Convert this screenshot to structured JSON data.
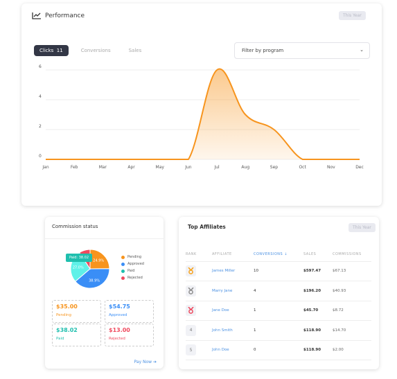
{
  "performance": {
    "title": "Performance",
    "badge": "This Year",
    "tabs": [
      {
        "label": "Clicks",
        "count": "11",
        "active": true
      },
      {
        "label": "Conversions"
      },
      {
        "label": "Sales"
      }
    ],
    "filter_placeholder": "Filter by program"
  },
  "chart_data": {
    "type": "area",
    "categories": [
      "Jan",
      "Feb",
      "Mar",
      "Apr",
      "May",
      "Jun",
      "Jul",
      "Aug",
      "Sep",
      "Oct",
      "Nov",
      "Dec"
    ],
    "values": [
      0,
      0,
      0,
      0,
      0,
      0,
      6,
      3,
      2,
      0,
      0,
      0
    ],
    "ylim": [
      0,
      6
    ],
    "yticks": [
      "0",
      "2",
      "4",
      "6"
    ],
    "color": "#f7941d",
    "grid": true
  },
  "commission": {
    "title": "Commission status",
    "legend": [
      {
        "label": "Pending",
        "color": "#f7941d"
      },
      {
        "label": "Approved",
        "color": "#3a8ef6"
      },
      {
        "label": "Paid",
        "color": "#1fbfae"
      },
      {
        "label": "Rejected",
        "color": "#ef4a5e"
      }
    ],
    "pie": [
      {
        "label": "Pending",
        "value": 35,
        "pct": "24.9%",
        "color": "#f7941d"
      },
      {
        "label": "Approved",
        "value": 54.75,
        "pct": "38.9%",
        "color": "#3a8ef6"
      },
      {
        "label": "Paid",
        "value": 38.02,
        "pct": "27.0%",
        "color": "#5ff1e8"
      },
      {
        "label": "Rejected",
        "value": 13,
        "pct": "9.2%",
        "color": "#ef4a5e"
      }
    ],
    "tooltip": "Paid: 38.02",
    "boxes": [
      {
        "value": "$35.00",
        "label": "Pending",
        "color": "#f7941d"
      },
      {
        "value": "$54.75",
        "label": "Approved",
        "color": "#3a8ef6"
      },
      {
        "value": "$38.02",
        "label": "Paid",
        "color": "#1fbfae"
      },
      {
        "value": "$13.00",
        "label": "Rejected",
        "color": "#ef4a5e"
      }
    ],
    "pay_now": "Pay Now ➔"
  },
  "affiliates": {
    "title": "Top Affiliates",
    "badge": "This Year",
    "columns": [
      "RANK",
      "AFFILIATE",
      "CONVERSIONS ↓",
      "SALES",
      "COMMISSIONS"
    ],
    "rows": [
      {
        "rank": "gold-medal",
        "name": "James Miller",
        "conversions": "10",
        "sales": "$597.47",
        "commissions": "$67.13"
      },
      {
        "rank": "silver-medal",
        "name": "Marry Jane",
        "conversions": "4",
        "sales": "$196.20",
        "commissions": "$40.93"
      },
      {
        "rank": "bronze-medal",
        "name": "Jane Doe",
        "conversions": "1",
        "sales": "$45.70",
        "commissions": "$8.72"
      },
      {
        "rank": "4",
        "name": "John Smith",
        "conversions": "1",
        "sales": "$118.90",
        "commissions": "$14.70"
      },
      {
        "rank": "5",
        "name": "John Doe",
        "conversions": "0",
        "sales": "$118.90",
        "commissions": "$2.00"
      }
    ]
  }
}
